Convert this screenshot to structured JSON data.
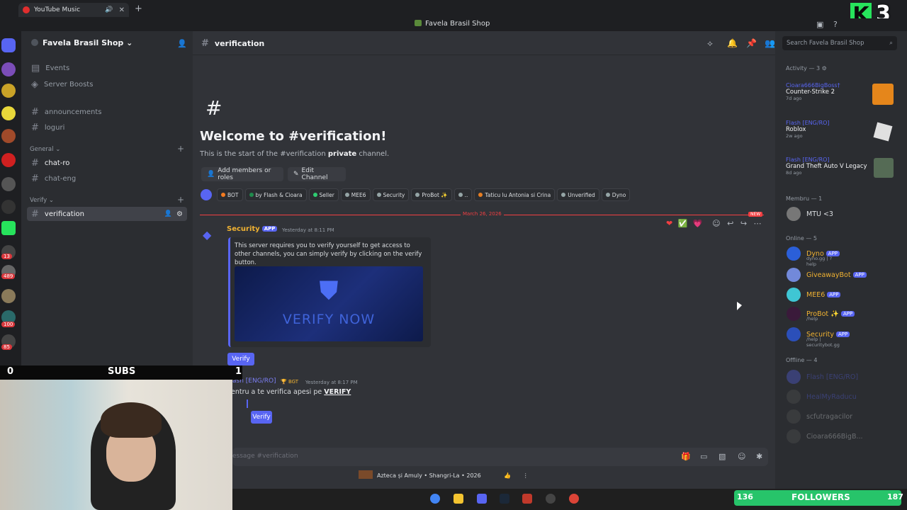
{
  "browser": {
    "tab_title": "YouTube Music",
    "new_tab": "+"
  },
  "window": {
    "title": "Favela Brasil Shop"
  },
  "stream": {
    "k_count": "3",
    "subs_count": "0",
    "subs_label": "SUBS",
    "subs_goal": "1",
    "followers_count": "136",
    "followers_label": "FOLLOWERS",
    "followers_goal": "187"
  },
  "server": {
    "name": "Favela Brasil Shop",
    "top_items": [
      {
        "label": "Events"
      },
      {
        "label": "Server Boosts"
      }
    ],
    "channels_top": [
      {
        "label": "announcements"
      },
      {
        "label": "loguri"
      }
    ],
    "categories": [
      {
        "label": "General",
        "channels": [
          {
            "label": "chat-ro"
          },
          {
            "label": "chat-eng"
          }
        ]
      },
      {
        "label": "Verify",
        "channels": [
          {
            "label": "verification"
          }
        ]
      }
    ],
    "rail_badges": [
      "13",
      "489",
      "100",
      "85"
    ]
  },
  "channel": {
    "name": "verification",
    "welcome": "Welcome to #verification!",
    "start_prefix": "This is the start of the #verification ",
    "start_bold": "private",
    "start_suffix": " channel.",
    "add_members": "Add members or roles",
    "edit_channel": "Edit Channel",
    "roles": [
      {
        "label": "BOT",
        "color": "#f47b20"
      },
      {
        "label": "by Flash & Cioara",
        "color": "#1f8b4c"
      },
      {
        "label": "Seller",
        "color": "#2ecc71"
      },
      {
        "label": "MEE6",
        "color": "#95a5a6"
      },
      {
        "label": "Security",
        "color": "#95a5a6"
      },
      {
        "label": "ProBot ✨",
        "color": "#95a5a6"
      },
      {
        "label": "..",
        "color": "#95a5a6"
      },
      {
        "label": "Taticu lu Antonia si Crina",
        "color": "#e67e22"
      },
      {
        "label": "Unverified",
        "color": "#95a5a6"
      },
      {
        "label": "Dyno",
        "color": "#95a5a6"
      }
    ],
    "divider_date": "March 26, 2026",
    "new_badge": "NEW",
    "search_placeholder": "Search Favela Brasil Shop",
    "input_placeholder": "essage #verification"
  },
  "messages": [
    {
      "author": "Security",
      "badge": "APP",
      "time": "Yesterday at 8:11 PM",
      "embed_text": "This server requires you to verify yourself to get access to other channels, you can simply verify by clicking on the verify button.",
      "image_text": "VERIFY NOW",
      "button": "Verify"
    },
    {
      "author": "ash [ENG/RO]",
      "badge": "BGT",
      "time": "Yesterday at 8:17 PM",
      "text_prefix": "entru a te verifica apesi pe ",
      "text_bold": "VERIFY",
      "button": "Verify"
    }
  ],
  "reactions": [
    "❤",
    "✅",
    "💗"
  ],
  "members": {
    "activity_header": "Activity — 3",
    "activity": [
      {
        "name": "Cioara666BigBoss†",
        "game": "Counter-Strike 2",
        "time": "7d ago"
      },
      {
        "name": "Flash [ENG/RO]",
        "game": "Roblox",
        "time": "2w ago"
      },
      {
        "name": "Flash [ENG/RO]",
        "game": "Grand Theft Auto V Legacy",
        "time": "8d ago"
      }
    ],
    "membru_header": "Membru — 1",
    "membru": [
      {
        "name": "MTU <3"
      }
    ],
    "online_header": "Online — 5",
    "online": [
      {
        "name": "Dyno",
        "sub": "dyno.gg | ?help",
        "color": "#f0b232"
      },
      {
        "name": "GiveawayBot",
        "sub": "",
        "color": "#f0b232"
      },
      {
        "name": "MEE6",
        "sub": "",
        "color": "#f0b232"
      },
      {
        "name": "ProBot ✨",
        "sub": "/help",
        "color": "#f0b232"
      },
      {
        "name": "Security",
        "sub": "/help | securitybot.gg",
        "color": "#f0b232"
      }
    ],
    "offline_header": "Offline — 4",
    "offline": [
      {
        "name": "Flash [ENG/RO]"
      },
      {
        "name": "HealMyRaducu"
      },
      {
        "name": "scfutragacilor"
      },
      {
        "name": "Cioara666BigB..."
      }
    ]
  },
  "media": {
    "now_playing": "Azteca și Amuly • Shangri-La • 2026"
  }
}
